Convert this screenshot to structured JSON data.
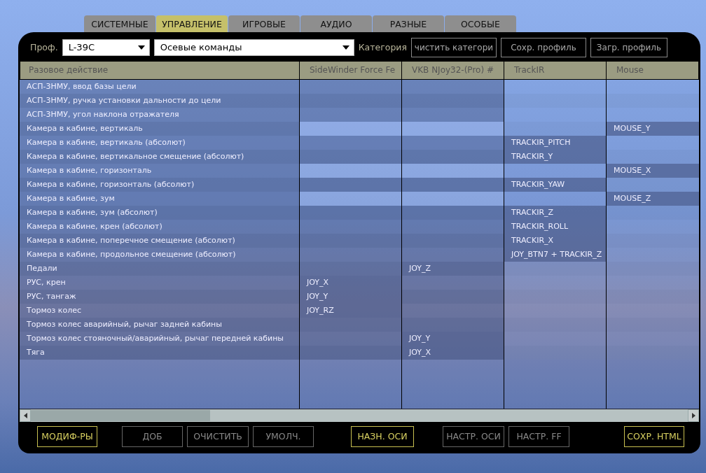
{
  "tabs": [
    {
      "label": "СИСТЕМНЫЕ",
      "selected": false
    },
    {
      "label": "УПРАВЛЕНИЕ",
      "selected": true
    },
    {
      "label": "ИГРОВЫЕ",
      "selected": false
    },
    {
      "label": "АУДИО",
      "selected": false
    },
    {
      "label": "РАЗНЫЕ",
      "selected": false
    },
    {
      "label": "ОСОБЫЕ",
      "selected": false
    }
  ],
  "toolbar": {
    "profile_label": "Проф.",
    "profile_value": "L-39C",
    "category_value": "Осевые команды",
    "category_label": "Категория",
    "buttons": [
      "чистить категори",
      "Сохр. профиль",
      "Загр. профиль"
    ]
  },
  "table": {
    "columns": [
      "Разовое действие",
      "SideWinder Force Fe",
      "VKB NJoy32-(Pro)  #",
      "TrackIR",
      "Mouse"
    ],
    "rows": [
      {
        "highlighted": false,
        "cells": [
          "АСП-3НМУ, ввод базы цели",
          null,
          null,
          null,
          null
        ]
      },
      {
        "highlighted": false,
        "cells": [
          "АСП-3НМУ, ручка установки дальности до цели",
          null,
          null,
          null,
          null
        ]
      },
      {
        "highlighted": false,
        "cells": [
          "АСП-3НМУ, угол наклона отражателя",
          null,
          null,
          null,
          null
        ]
      },
      {
        "highlighted": true,
        "cells": [
          "Камера в кабине, вертикаль",
          null,
          null,
          null,
          "MOUSE_Y"
        ]
      },
      {
        "highlighted": false,
        "cells": [
          "Камера в кабине, вертикаль (абсолют)",
          null,
          null,
          "TRACKIR_PITCH",
          null
        ]
      },
      {
        "highlighted": false,
        "cells": [
          "Камера в кабине, вертикальное смещение (абсолют)",
          null,
          null,
          "TRACKIR_Y",
          null
        ]
      },
      {
        "highlighted": true,
        "cells": [
          "Камера в кабине, горизонталь",
          null,
          null,
          null,
          "MOUSE_X"
        ]
      },
      {
        "highlighted": false,
        "cells": [
          "Камера в кабине, горизонталь (абсолют)",
          null,
          null,
          "TRACKIR_YAW",
          null
        ]
      },
      {
        "highlighted": true,
        "cells": [
          "Камера в кабине, зум",
          null,
          null,
          null,
          "MOUSE_Z"
        ]
      },
      {
        "highlighted": false,
        "cells": [
          "Камера в кабине, зум (абсолют)",
          null,
          null,
          "TRACKIR_Z",
          null
        ]
      },
      {
        "highlighted": false,
        "cells": [
          "Камера в кабине, крен (абсолют)",
          null,
          null,
          "TRACKIR_ROLL",
          null
        ]
      },
      {
        "highlighted": false,
        "cells": [
          "Камера в кабине, поперечное смещение (абсолют)",
          null,
          null,
          "TRACKIR_X",
          null
        ]
      },
      {
        "highlighted": false,
        "cells": [
          "Камера в кабине, продольное смещение (абсолют)",
          null,
          null,
          "JOY_BTN7 + TRACKIR_Z",
          null
        ]
      },
      {
        "highlighted": false,
        "cells": [
          "Педали",
          null,
          "JOY_Z",
          null,
          null
        ]
      },
      {
        "highlighted": false,
        "cells": [
          "РУС, крен",
          "JOY_X",
          null,
          null,
          null
        ]
      },
      {
        "highlighted": false,
        "cells": [
          "РУС, тангаж",
          "JOY_Y",
          null,
          null,
          null
        ]
      },
      {
        "highlighted": false,
        "cells": [
          "Тормоз колес",
          "JOY_RZ",
          null,
          null,
          null
        ]
      },
      {
        "highlighted": false,
        "cells": [
          "Тормоз колес аварийный, рычаг задней кабины",
          null,
          null,
          null,
          null
        ]
      },
      {
        "highlighted": false,
        "cells": [
          "Тормоз колес стояночный/аварийный, рычаг передней кабины",
          null,
          "JOY_Y",
          null,
          null
        ]
      },
      {
        "highlighted": false,
        "cells": [
          "Тяга",
          null,
          "JOY_X",
          null,
          null
        ]
      }
    ]
  },
  "bottom_buttons": [
    {
      "label": "МОДИФ-РЫ",
      "enabled": true
    },
    {
      "label": "ДОБ",
      "enabled": false
    },
    {
      "label": "ОЧИСТИТЬ",
      "enabled": false
    },
    {
      "label": "УМОЛЧ.",
      "enabled": false
    },
    {
      "label": "НАЗН. ОСИ",
      "enabled": true
    },
    {
      "label": "НАСТР. ОСИ",
      "enabled": false
    },
    {
      "label": "НАСТР. FF",
      "enabled": false
    },
    {
      "label": "СОХР. HTML",
      "enabled": true
    }
  ]
}
